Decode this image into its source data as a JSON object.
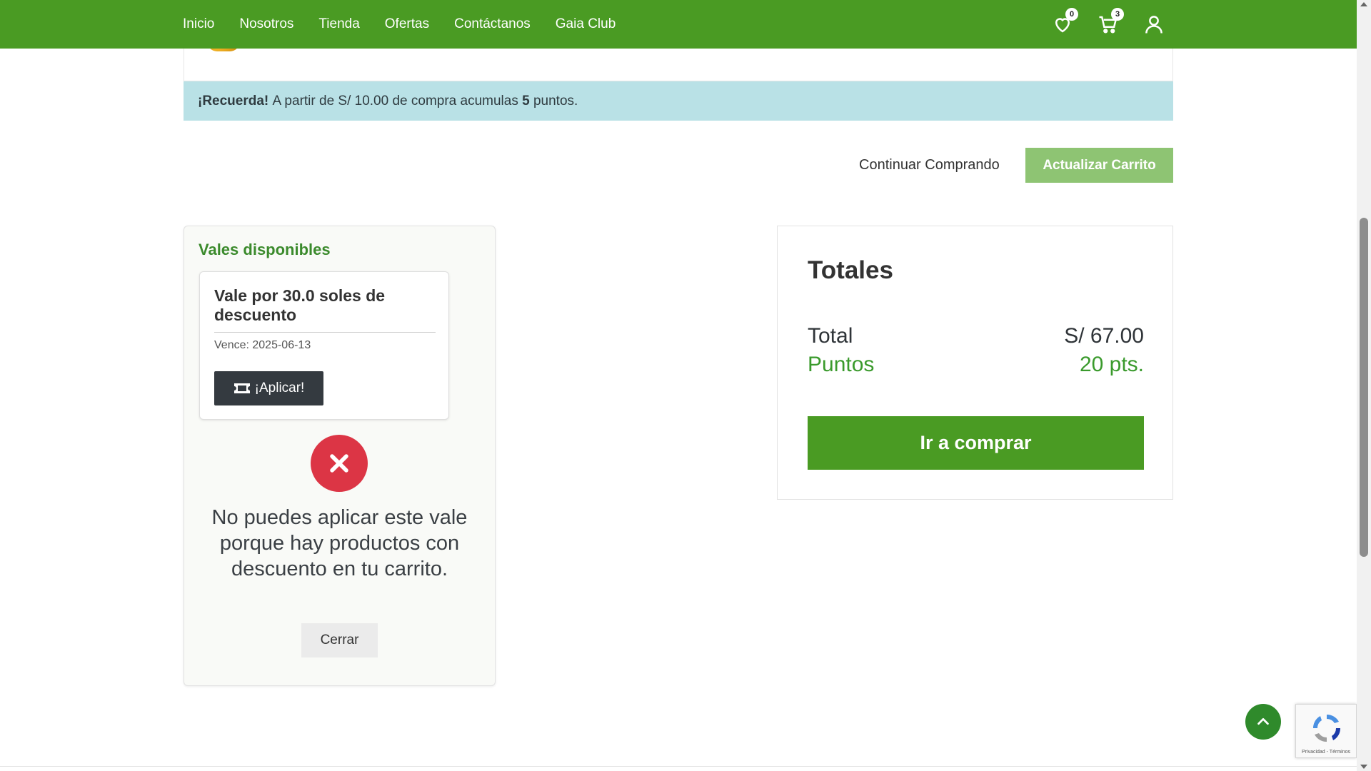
{
  "nav": {
    "links": [
      "Inicio",
      "Nosotros",
      "Tienda",
      "Ofertas",
      "Contáctanos",
      "Gaia Club"
    ],
    "wishlist_count": "0",
    "cart_count": "3",
    "brand_color": "#4a9b23"
  },
  "notice": {
    "bold_lead": "¡Recuerda!",
    "text_part1": "A partir de S/ 10.00 de compra acumulas",
    "points": "5",
    "text_part2": "puntos."
  },
  "actions": {
    "continue_label": "Continuar Comprando",
    "update_label": "Actualizar Carrito"
  },
  "vouchers": {
    "title": "Vales disponibles",
    "items": [
      {
        "name": "Vale por 30.0 soles de descuento",
        "expiry": "Vence: 2025-06-13",
        "apply_label": "¡Aplicar!"
      }
    ],
    "error_message": "No puedes aplicar este vale porque hay productos con descuento en tu carrito.",
    "close_label": "Cerrar"
  },
  "totals": {
    "title": "Totales",
    "total_label": "Total",
    "total_value": "S/ 67.00",
    "points_label": "Puntos",
    "points_value": "20 pts.",
    "checkout_label": "Ir a comprar"
  },
  "recaptcha": {
    "footer_text": "Privacidad - Términos"
  },
  "icons": [
    "heart-icon",
    "cart-icon",
    "user-icon",
    "ticket-icon",
    "close-icon",
    "chevron-up-icon",
    "recaptcha-icon"
  ]
}
